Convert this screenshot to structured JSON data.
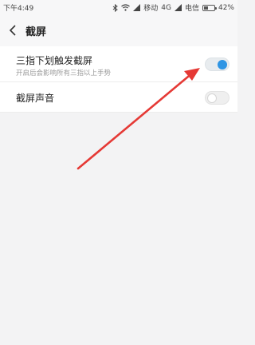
{
  "status_bar": {
    "time": "下午4:49",
    "network": "4G",
    "carrier_1": "移动",
    "carrier_2": "电信",
    "battery_text": "42%",
    "battery_level": 0.42
  },
  "header": {
    "title": "截屏"
  },
  "settings": [
    {
      "title": "三指下划触发截屏",
      "subtitle": "开启后会影响所有三指以上手势",
      "enabled": true
    },
    {
      "title": "截屏声音",
      "enabled": false
    }
  ],
  "colors": {
    "toggle_on": "#2f95e4",
    "annotation_arrow": "#e53935"
  }
}
